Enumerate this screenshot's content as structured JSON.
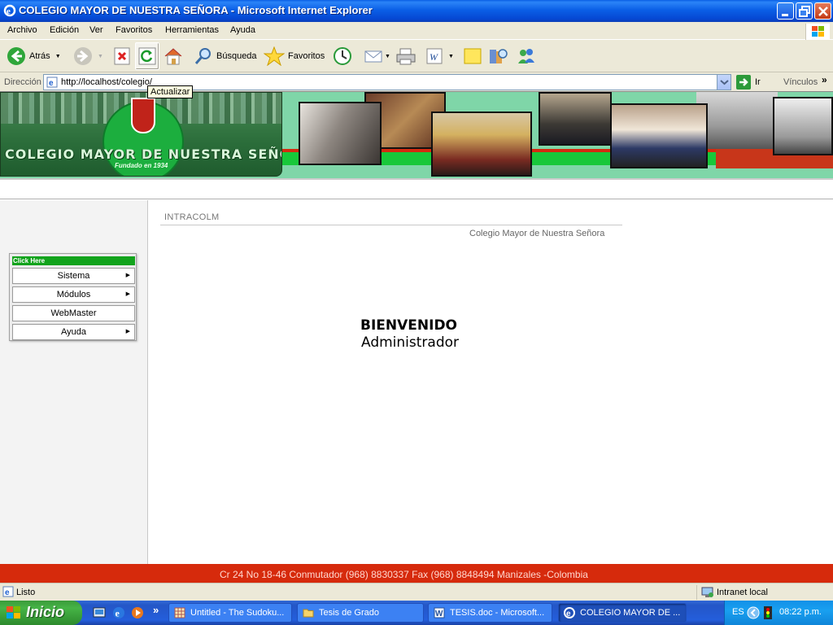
{
  "window": {
    "title": "COLEGIO MAYOR DE NUESTRA SEÑORA - Microsoft Internet Explorer"
  },
  "menu": [
    "Archivo",
    "Edición",
    "Ver",
    "Favoritos",
    "Herramientas",
    "Ayuda"
  ],
  "toolbar": {
    "back_label": "Atrás",
    "search_label": "Búsqueda",
    "favorites_label": "Favoritos"
  },
  "address": {
    "label": "Dirección",
    "url": "http://localhost/colegio/",
    "go_label": "Ir",
    "links_label": "Vínculos",
    "links_more": "»"
  },
  "tooltip": "Actualizar",
  "banner": {
    "school_name": "COLEGIO MAYOR DE NUESTRA SEÑORA",
    "founded": "Fundado en 1934"
  },
  "sidebar": {
    "menu_header": "Click Here",
    "items": [
      {
        "label": "Sistema",
        "submenu": true
      },
      {
        "label": "Módulos",
        "submenu": true
      },
      {
        "label": "WebMaster",
        "submenu": false
      },
      {
        "label": "Ayuda",
        "submenu": true
      }
    ]
  },
  "content": {
    "section_title": "INTRACOLM",
    "subtitle": "Colegio Mayor de Nuestra Señora",
    "welcome": "BIENVENIDO",
    "user": "Administrador"
  },
  "footer": {
    "address": "Cr 24 No 18-46 Conmutador (968) 8830337 Fax (968) 8848494 Manizales -Colombia"
  },
  "status": {
    "text": "Listo",
    "zone": "Intranet local"
  },
  "taskbar": {
    "start_label": "Inicio",
    "quicklaunch_more": "»",
    "tasks": [
      {
        "label": "Untitled - The Sudoku...",
        "active": false
      },
      {
        "label": "Tesis de Grado",
        "active": false
      },
      {
        "label": "TESIS.doc - Microsoft...",
        "active": false
      },
      {
        "label": "COLEGIO MAYOR DE ...",
        "active": true
      }
    ],
    "language": "ES",
    "clock": "08:22 p.m."
  }
}
